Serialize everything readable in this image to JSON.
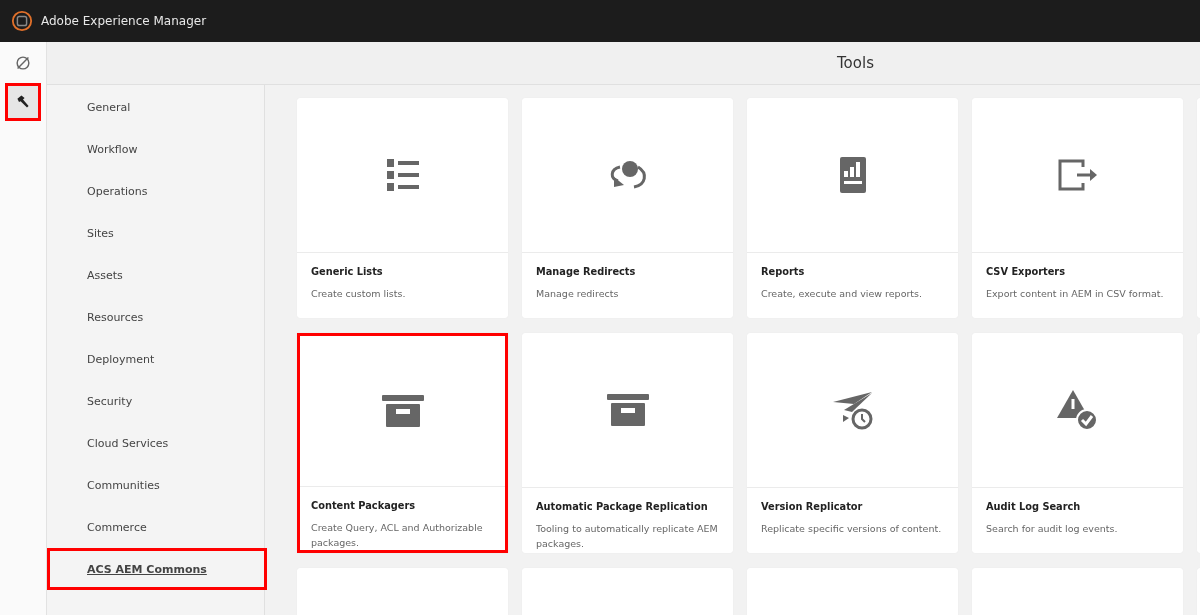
{
  "app": {
    "title": "Adobe Experience Manager"
  },
  "rail": [
    {
      "selected": false,
      "highlighted": false
    },
    {
      "selected": true,
      "highlighted": true
    }
  ],
  "header": {
    "title": "Tools"
  },
  "nav": [
    {
      "label": "General",
      "selected": false,
      "highlighted": false
    },
    {
      "label": "Workflow",
      "selected": false,
      "highlighted": false
    },
    {
      "label": "Operations",
      "selected": false,
      "highlighted": false
    },
    {
      "label": "Sites",
      "selected": false,
      "highlighted": false
    },
    {
      "label": "Assets",
      "selected": false,
      "highlighted": false
    },
    {
      "label": "Resources",
      "selected": false,
      "highlighted": false
    },
    {
      "label": "Deployment",
      "selected": false,
      "highlighted": false
    },
    {
      "label": "Security",
      "selected": false,
      "highlighted": false
    },
    {
      "label": "Cloud Services",
      "selected": false,
      "highlighted": false
    },
    {
      "label": "Communities",
      "selected": false,
      "highlighted": false
    },
    {
      "label": "Commerce",
      "selected": false,
      "highlighted": false
    },
    {
      "label": "ACS AEM Commons",
      "selected": true,
      "highlighted": true
    }
  ],
  "tools": [
    {
      "kind": "tool",
      "title": "Generic Lists",
      "description": "Create custom lists.",
      "highlighted": false
    },
    {
      "kind": "tool",
      "title": "Manage Redirects",
      "description": "Manage redirects",
      "highlighted": false
    },
    {
      "kind": "tool",
      "title": "Reports",
      "description": "Create, execute and view reports.",
      "highlighted": false
    },
    {
      "kind": "tool",
      "title": "CSV Exporters",
      "description": "Export content in AEM in CSV format.",
      "highlighted": false
    },
    {
      "kind": "blank"
    },
    {
      "kind": "tool",
      "title": "Content Packagers",
      "description": "Create Query, ACL and Authorizable packages.",
      "highlighted": true
    },
    {
      "kind": "tool",
      "title": "Automatic Package Replication",
      "description": "Tooling to automatically replicate AEM packages.",
      "highlighted": false
    },
    {
      "kind": "tool",
      "title": "Version Replicator",
      "description": "Replicate specific versions of content.",
      "highlighted": false
    },
    {
      "kind": "tool",
      "title": "Audit Log Search",
      "description": "Search for audit log events.",
      "highlighted": false
    },
    {
      "kind": "blank"
    },
    {
      "kind": "blank"
    },
    {
      "kind": "blank"
    },
    {
      "kind": "blank"
    },
    {
      "kind": "blank"
    },
    {
      "kind": "blank"
    }
  ]
}
